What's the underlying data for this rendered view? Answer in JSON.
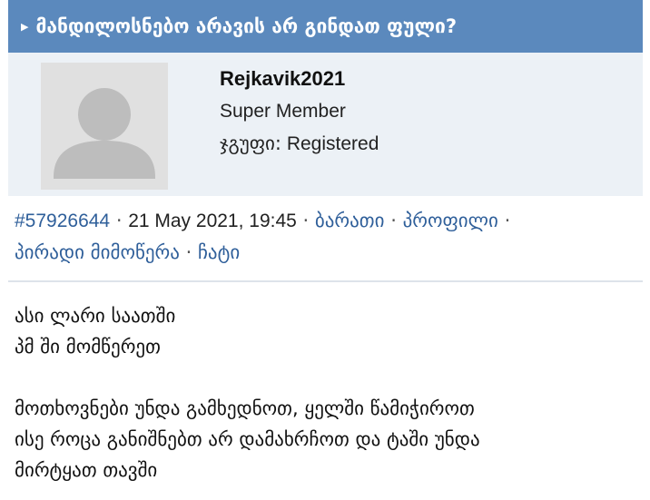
{
  "topic": {
    "title": "მანდილოსნებო არავის არ გინდათ ფული?"
  },
  "author": {
    "username": "Rejkavik2021",
    "rank": "Super Member",
    "group_label": "ჯგუფი:",
    "group_value": "Registered"
  },
  "post_meta": {
    "post_id": "#57926644",
    "date": "21 May 2021, 19:45",
    "link_card": "ბარათი",
    "link_profile": "პროფილი",
    "link_pm": "პირადი მიმოწერა",
    "link_chat": "ჩატი",
    "separator": "·"
  },
  "post": {
    "line1": "ასი ლარი საათში",
    "line2": "პმ ში მომწერეთ",
    "line3": "მოთხოვნები უნდა გამხედნოთ, ყელში წამიჭიროთ",
    "line4": "ისე როცა განიშნებთ არ დამახრჩოთ და ტაში უნდა",
    "line5": "მირტყათ თავში"
  },
  "colors": {
    "header_bg": "#5b89bd",
    "author_panel_bg": "#ecf1f6",
    "link": "#2f5f9a"
  }
}
